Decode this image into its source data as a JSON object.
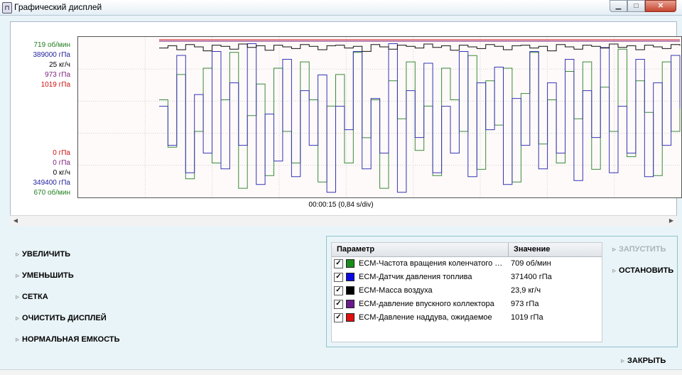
{
  "window": {
    "title": "Графический дисплей",
    "icon": "gauge-app-icon",
    "controls": {
      "minimize": "▁",
      "maximize": "□",
      "close": "✕"
    }
  },
  "graph": {
    "left_labels_top": [
      {
        "text": "719 об/мин",
        "color": "#1f7d1f"
      },
      {
        "text": "389000 гПа",
        "color": "#2323a0"
      },
      {
        "text": "25 кг/ч",
        "color": "#000000"
      },
      {
        "text": "973 гПа",
        "color": "#7a1f7a"
      },
      {
        "text": "1019 гПа",
        "color": "#d01010"
      }
    ],
    "left_labels_bottom": [
      {
        "text": "0 гПа",
        "color": "#d01010"
      },
      {
        "text": "0 гПа",
        "color": "#7a1f7a"
      },
      {
        "text": "0 кг/ч",
        "color": "#000000"
      },
      {
        "text": "349400 гПа",
        "color": "#2323a0"
      },
      {
        "text": "670 об/мин",
        "color": "#1f7d1f"
      }
    ],
    "time_label": "00:00:15 (0,84 s/div)"
  },
  "commands": [
    {
      "label": "УВЕЛИЧИТЬ",
      "name": "zoom-in-button"
    },
    {
      "label": "УМЕНЬШИТЬ",
      "name": "zoom-out-button"
    },
    {
      "label": "СЕТКА",
      "name": "grid-button"
    },
    {
      "label": "ОЧИСТИТЬ ДИСПЛЕЙ",
      "name": "clear-display-button"
    },
    {
      "label": "НОРМАЛЬНАЯ ЕМКОСТЬ",
      "name": "normal-capacity-button"
    }
  ],
  "actions": {
    "start": "ЗАПУСТИТЬ",
    "stop": "ОСТАНОВИТЬ",
    "close": "ЗАКРЫТЬ"
  },
  "legend": {
    "header_param": "Параметр",
    "header_value": "Значение",
    "rows": [
      {
        "name": "ECM-Частота вращения коленчатого вала",
        "value": "709 об/мин",
        "color": "#1a8c1a",
        "checked": true
      },
      {
        "name": "ECM-Датчик давления топлива",
        "value": "371400 гПа",
        "color": "#0a0ae0",
        "checked": true
      },
      {
        "name": "ECM-Масса воздуха",
        "value": "23,9 кг/ч",
        "color": "#000000",
        "checked": true
      },
      {
        "name": "ECM-давление впускного коллектора",
        "value": "973 гПа",
        "color": "#6b1a8c",
        "checked": true
      },
      {
        "name": "ECM-Давление наддува, ожидаемое",
        "value": "1019 гПа",
        "color": "#e01010",
        "checked": true
      }
    ]
  },
  "chart_data": {
    "type": "line",
    "title": "",
    "xlabel": "00:00:15 (0,84 s/div)",
    "grid": true,
    "series": [
      {
        "name": "ECM-Частота вращения коленчатого вала",
        "color": "#3a8a3a",
        "ylim": [
          670,
          719
        ],
        "values": [
          700,
          685,
          708,
          675,
          690,
          710,
          680,
          700,
          715,
          672,
          695,
          705,
          676,
          710,
          690,
          680,
          712,
          700,
          674,
          698,
          708,
          680,
          715,
          688,
          700,
          672,
          706,
          694,
          712,
          684,
          698,
          676,
          710,
          700,
          690,
          714,
          678,
          706,
          692,
          710,
          674,
          702,
          715,
          686,
          700,
          680,
          709,
          694,
          712,
          678,
          704,
          690,
          716,
          682,
          706,
          696,
          676,
          712,
          690,
          708
        ]
      },
      {
        "name": "ECM-Датчик давления топлива",
        "color": "#3535b5",
        "ylim": [
          349400,
          389000
        ],
        "values": [
          372000,
          362000,
          385000,
          355000,
          375000,
          360000,
          386000,
          356000,
          378000,
          362000,
          388000,
          352000,
          370000,
          358000,
          384000,
          354000,
          376000,
          362000,
          380000,
          350000,
          372000,
          366000,
          386000,
          356000,
          374000,
          360000,
          388000,
          350000,
          376000,
          364000,
          383000,
          355000,
          372000,
          360000,
          386000,
          354000,
          378000,
          366000,
          382000,
          352000,
          374000,
          362000,
          386000,
          356000,
          378000,
          360000,
          384000,
          353000,
          376000,
          364000,
          387000,
          355000,
          372000,
          360000,
          384000,
          354000,
          378000,
          362000,
          385000,
          371400
        ]
      },
      {
        "name": "ECM-Масса воздуха",
        "color": "#111111",
        "ylim": [
          0,
          25
        ],
        "values": [
          23.5,
          23.9,
          23.2,
          24.1,
          23.7,
          23.0,
          24.0,
          23.8,
          23.3,
          24.2,
          23.6,
          23.9,
          23.1,
          24.0,
          23.7,
          23.4,
          24.1,
          23.8,
          23.2,
          23.9,
          24.0,
          23.5,
          23.8,
          22.9,
          24.1,
          23.7,
          23.3,
          24.0,
          23.8,
          23.5,
          24.2,
          23.6,
          23.9,
          23.1,
          24.0,
          23.7,
          23.4,
          24.1,
          23.8,
          23.2,
          23.9,
          24.0,
          23.5,
          23.8,
          23.0,
          24.1,
          23.7,
          23.3,
          24.0,
          23.8,
          23.5,
          24.2,
          23.6,
          23.9,
          23.2,
          24.0,
          23.7,
          23.4,
          24.1,
          23.9
        ]
      },
      {
        "name": "ECM-давление впускного коллектора",
        "color": "#7a1f7a",
        "ylim": [
          0,
          973
        ],
        "values": [
          973,
          973
        ]
      },
      {
        "name": "ECM-Давление наддува, ожидаемое",
        "color": "#d01010",
        "ylim": [
          0,
          1019
        ],
        "values": [
          1019,
          1019
        ]
      }
    ]
  }
}
